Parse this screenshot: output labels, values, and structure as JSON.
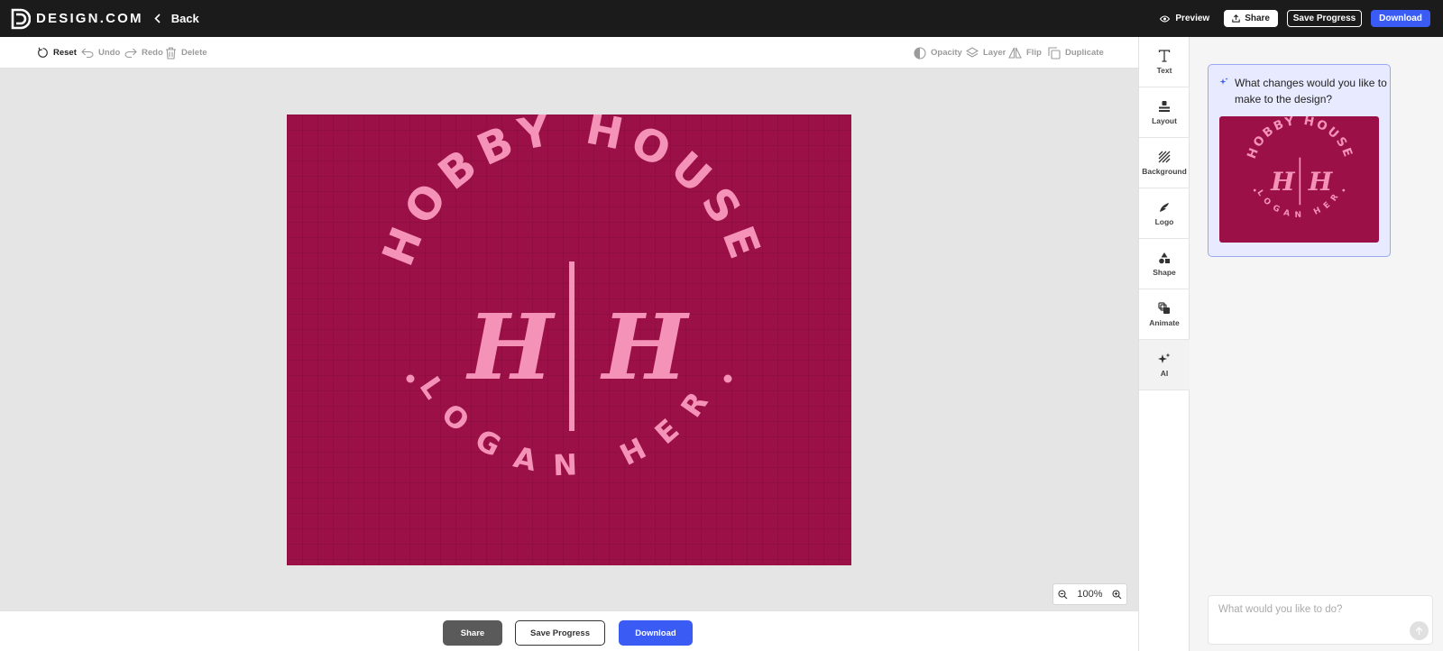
{
  "topbar": {
    "brand": "DESIGN.COM",
    "back_label": "Back",
    "preview_label": "Preview",
    "share_label": "Share",
    "save_label": "Save Progress",
    "download_label": "Download"
  },
  "toolbar": {
    "reset": "Reset",
    "undo": "Undo",
    "redo": "Redo",
    "delete": "Delete",
    "opacity": "Opacity",
    "layer": "Layer",
    "flip": "Flip",
    "duplicate": "Duplicate"
  },
  "design": {
    "top_text": "HOBBY HOUSE",
    "bottom_text": "SLOGAN HERE",
    "monogram_left": "H",
    "monogram_right": "H",
    "background_color": "#9c1048",
    "foreground_color": "#f592b8"
  },
  "zoom": {
    "level": "100%"
  },
  "bottombar": {
    "share_label": "Share",
    "save_label": "Save Progress",
    "download_label": "Download"
  },
  "rail": {
    "items": [
      {
        "label": "Text",
        "icon": "text-icon"
      },
      {
        "label": "Layout",
        "icon": "layout-icon"
      },
      {
        "label": "Background",
        "icon": "background-icon"
      },
      {
        "label": "Logo",
        "icon": "logo-icon"
      },
      {
        "label": "Shape",
        "icon": "shape-icon"
      },
      {
        "label": "Animate",
        "icon": "animate-icon"
      },
      {
        "label": "AI",
        "icon": "ai-sparkle-icon"
      }
    ]
  },
  "ai": {
    "question": "What changes would you like to make to the design?",
    "input_placeholder": "What would you like to do?"
  },
  "colors": {
    "accent": "#3b5bf5",
    "topbar": "#1b1b1b"
  }
}
